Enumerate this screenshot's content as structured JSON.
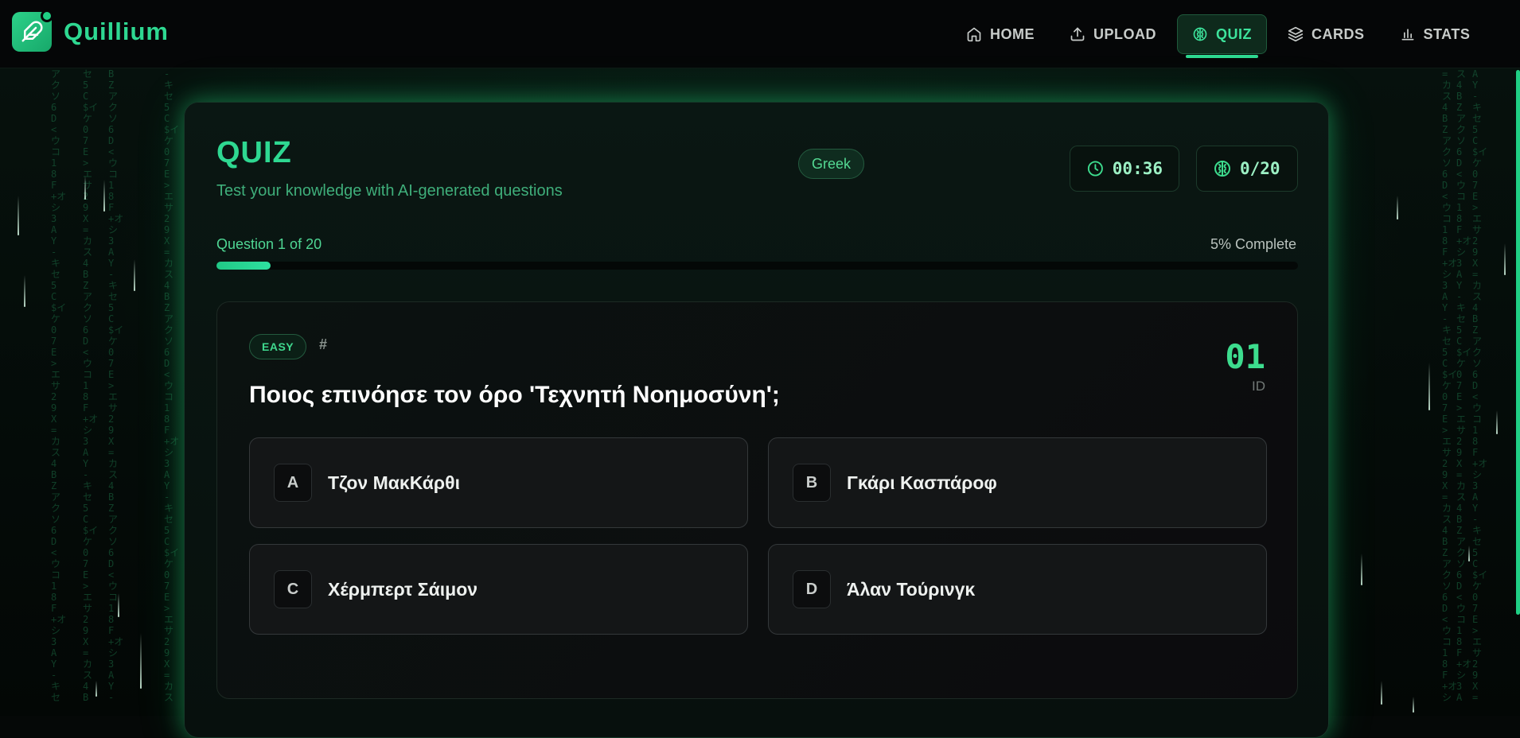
{
  "app": {
    "brand": "Quillium",
    "logo_icon": "feather-icon",
    "accent_color": "#2ed891"
  },
  "nav": {
    "items": [
      {
        "label": "HOME",
        "icon": "home-icon",
        "active": false
      },
      {
        "label": "UPLOAD",
        "icon": "upload-icon",
        "active": false
      },
      {
        "label": "QUIZ",
        "icon": "brain-icon",
        "active": true
      },
      {
        "label": "CARDS",
        "icon": "layers-icon",
        "active": false
      },
      {
        "label": "STATS",
        "icon": "bar-chart-icon",
        "active": false
      }
    ]
  },
  "quiz": {
    "title": "QUIZ",
    "subtitle": "Test your knowledge with AI-generated questions",
    "language": "Greek",
    "timer": "00:36",
    "score": "0/20",
    "progress_label": "Question 1 of 20",
    "progress_pct_label": "5% Complete",
    "progress_fraction": 0.05
  },
  "question": {
    "difficulty": "EASY",
    "hash_symbol": "#",
    "id": "01",
    "id_label": "ID",
    "text": "Ποιος επινόησε τον όρο 'Τεχνητή Νοημοσύνη';",
    "options": [
      {
        "letter": "A",
        "text": "Τζον ΜακΚάρθι"
      },
      {
        "letter": "B",
        "text": "Γκάρι Κασπάροφ"
      },
      {
        "letter": "C",
        "text": "Χέρμπερτ Σάιμον"
      },
      {
        "letter": "D",
        "text": "Άλαν Τούρινγκ"
      }
    ]
  }
}
